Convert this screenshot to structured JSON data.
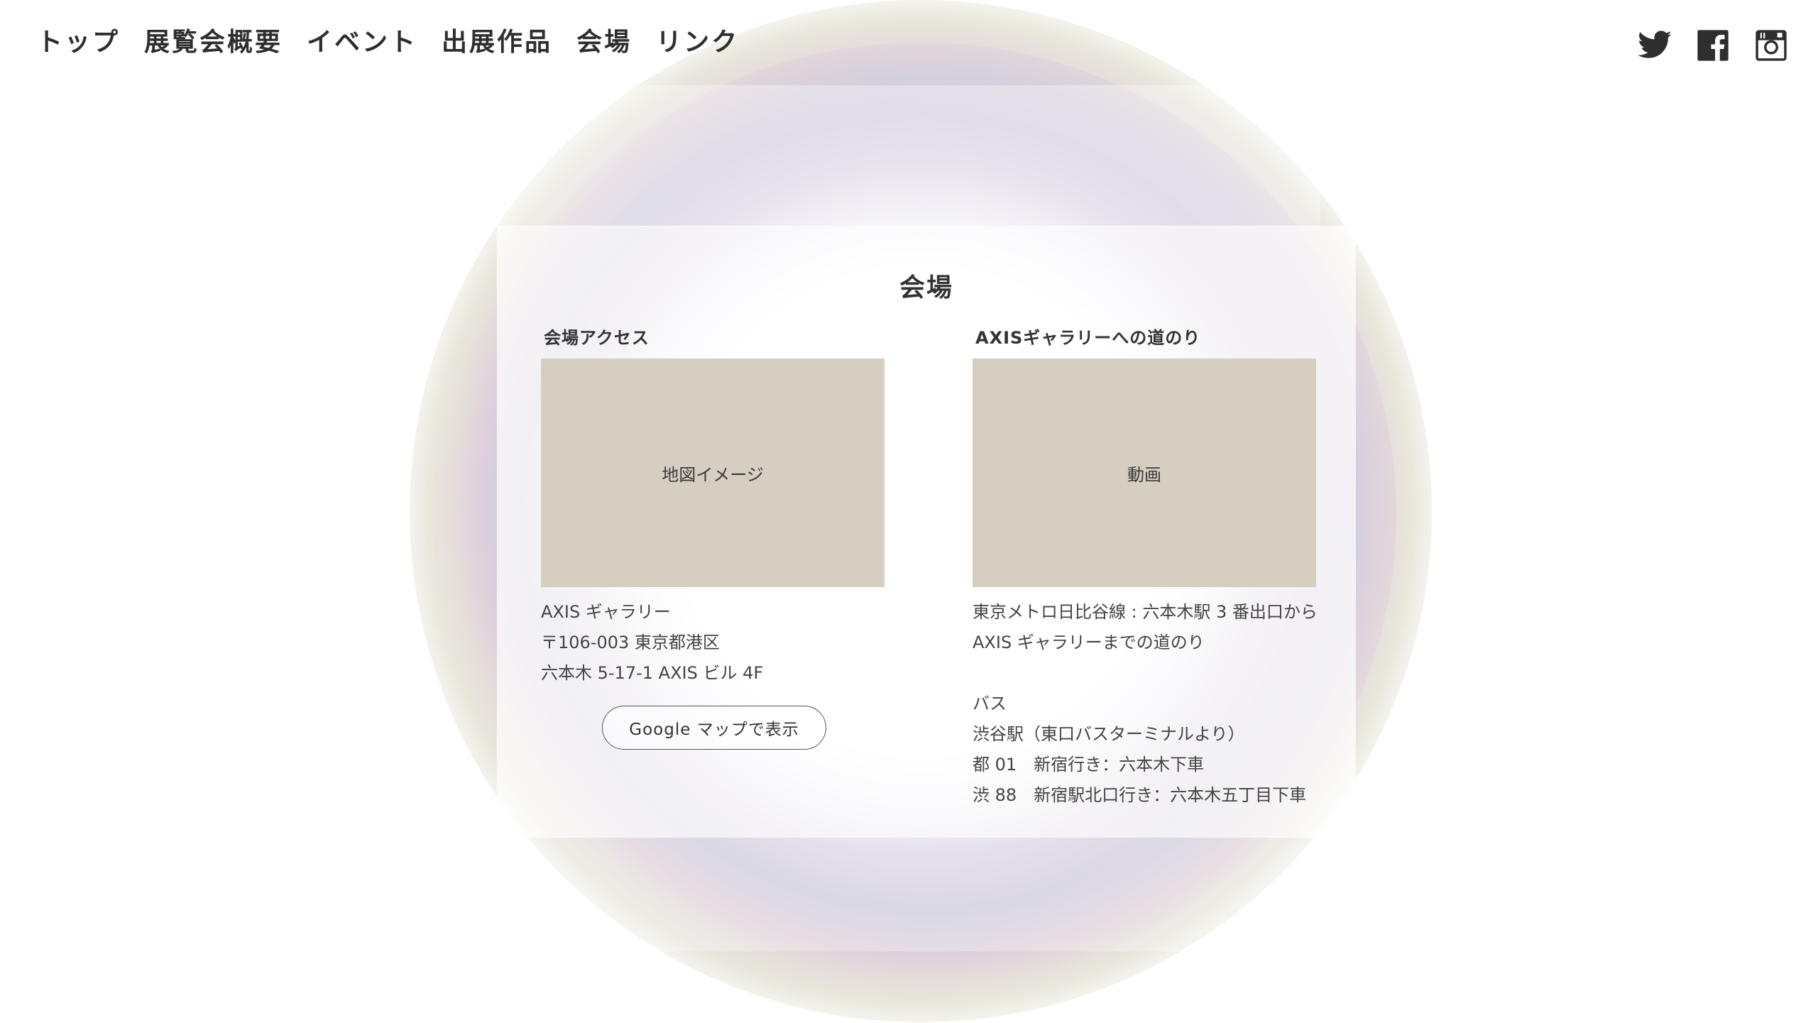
{
  "nav": {
    "items": [
      {
        "label": "トップ"
      },
      {
        "label": "展覧会概要"
      },
      {
        "label": "イベント"
      },
      {
        "label": "出展作品"
      },
      {
        "label": "会場"
      },
      {
        "label": "リンク"
      }
    ]
  },
  "social": {
    "icons": [
      "twitter-icon",
      "facebook-icon",
      "instagram-icon"
    ],
    "icon_color": "#2e2e2e"
  },
  "venue": {
    "title": "会場",
    "access": {
      "heading": "会場アクセス",
      "map_placeholder": "地図イメージ",
      "address_lines": [
        "AXIS ギャラリー",
        "〒106-003 東京都港区",
        "六本木 5-17-1 AXIS ビル 4F"
      ],
      "map_button": "Google マップで表示"
    },
    "route": {
      "heading": "AXISギャラリーへの道のり",
      "video_placeholder": "動画",
      "lines": [
        "東京メトロ日比谷線 : 六本木駅 3 番出口から",
        "AXIS ギャラリーまでの道のり",
        "",
        "バス",
        "渋谷駅（東口バスターミナルより）",
        "都 01　新宿行き：六本木下車",
        "渋 88　新宿駅北口行き：六本木五丁目下車"
      ]
    }
  },
  "colors": {
    "placeholder": "#d7cec2",
    "text": "#3a3a3a"
  }
}
